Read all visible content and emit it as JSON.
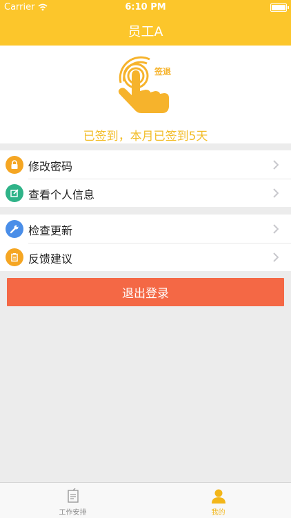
{
  "status_bar": {
    "carrier": "Carrier",
    "time": "6:10 PM"
  },
  "nav": {
    "title": "员工A"
  },
  "checkin": {
    "action_label": "签退",
    "status_text": "已签到，本月已签到5天"
  },
  "menu_group_1": [
    {
      "label": "修改密码",
      "icon": "lock-icon",
      "icon_color": "#f5a623"
    },
    {
      "label": "查看个人信息",
      "icon": "edit-icon",
      "icon_color": "#2fb388"
    }
  ],
  "menu_group_2": [
    {
      "label": "检查更新",
      "icon": "wrench-icon",
      "icon_color": "#4a8ee8"
    },
    {
      "label": "反馈建议",
      "icon": "clipboard-icon",
      "icon_color": "#f5a623"
    }
  ],
  "logout": {
    "label": "退出登录"
  },
  "tabs": [
    {
      "label": "工作安排",
      "icon": "schedule-icon"
    },
    {
      "label": "我的",
      "icon": "profile-icon",
      "active": true
    }
  ],
  "colors": {
    "brand": "#fcc62b",
    "logout": "#f46845",
    "status_text": "#f2bd28"
  }
}
